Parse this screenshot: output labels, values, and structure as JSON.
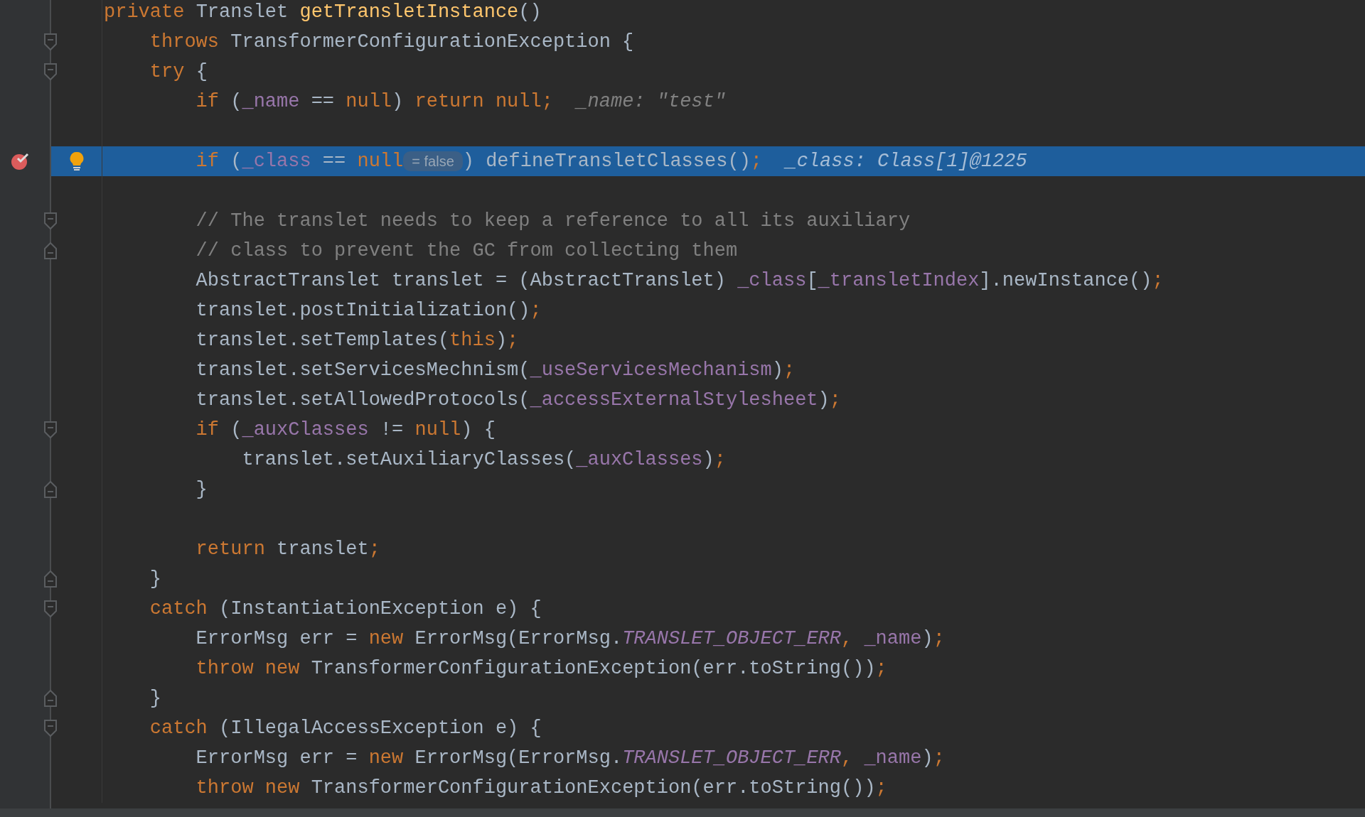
{
  "editor": {
    "lines": [
      {
        "tokens": [
          {
            "kind": "keyword",
            "text": "private "
          },
          {
            "kind": "plain",
            "text": "Translet "
          },
          {
            "kind": "method",
            "text": "getTransletInstance"
          },
          {
            "kind": "plain",
            "text": "()"
          }
        ]
      },
      {
        "fold_open": true,
        "tokens": [
          {
            "kind": "keyword",
            "text": "    throws "
          },
          {
            "kind": "plain",
            "text": "TransformerConfigurationException {"
          }
        ]
      },
      {
        "fold_open": true,
        "tokens": [
          {
            "kind": "keyword",
            "text": "    try "
          },
          {
            "kind": "plain",
            "text": "{"
          }
        ]
      },
      {
        "tokens": [
          {
            "kind": "keyword",
            "text": "        if "
          },
          {
            "kind": "plain",
            "text": "("
          },
          {
            "kind": "field",
            "text": "_name"
          },
          {
            "kind": "plain",
            "text": " == "
          },
          {
            "kind": "keyword",
            "text": "null"
          },
          {
            "kind": "plain",
            "text": ") "
          },
          {
            "kind": "keyword",
            "text": "return null;"
          },
          {
            "kind": "value",
            "text": "  _name: \"test\""
          }
        ]
      },
      {
        "selected": false
      },
      {
        "selected": true,
        "breakpoint": true,
        "bulb": true,
        "tokens": [
          {
            "kind": "keyword",
            "text": "        if "
          },
          {
            "kind": "plain",
            "text": "("
          },
          {
            "kind": "field",
            "text": "_class"
          },
          {
            "kind": "plain",
            "text": " == "
          },
          {
            "kind": "keyword",
            "text": "null"
          },
          {
            "kind": "inlay",
            "text": "= false"
          },
          {
            "kind": "plain",
            "text": ") defineTransletClasses()"
          },
          {
            "kind": "keyword",
            "text": ";"
          },
          {
            "kind": "value",
            "text": "  _class: Class[1]@1225"
          }
        ]
      },
      {
        "selected": false
      },
      {
        "fold_open": true,
        "tokens": [
          {
            "kind": "comment",
            "text": "        // The translet needs to keep a reference to all its auxiliary"
          }
        ]
      },
      {
        "fold_close": true,
        "tokens": [
          {
            "kind": "comment",
            "text": "        // class to prevent the GC from collecting them"
          }
        ]
      },
      {
        "tokens": [
          {
            "kind": "plain",
            "text": "        AbstractTranslet translet = (AbstractTranslet) "
          },
          {
            "kind": "field",
            "text": "_class"
          },
          {
            "kind": "plain",
            "text": "["
          },
          {
            "kind": "field",
            "text": "_transletIndex"
          },
          {
            "kind": "plain",
            "text": "].newInstance()"
          },
          {
            "kind": "keyword",
            "text": ";"
          }
        ]
      },
      {
        "tokens": [
          {
            "kind": "plain",
            "text": "        translet.postInitialization()"
          },
          {
            "kind": "keyword",
            "text": ";"
          }
        ]
      },
      {
        "tokens": [
          {
            "kind": "plain",
            "text": "        translet.setTemplates("
          },
          {
            "kind": "keyword",
            "text": "this"
          },
          {
            "kind": "plain",
            "text": ")"
          },
          {
            "kind": "keyword",
            "text": ";"
          }
        ]
      },
      {
        "tokens": [
          {
            "kind": "plain",
            "text": "        translet.setServicesMechnism("
          },
          {
            "kind": "field",
            "text": "_useServicesMechanism"
          },
          {
            "kind": "plain",
            "text": ")"
          },
          {
            "kind": "keyword",
            "text": ";"
          }
        ]
      },
      {
        "tokens": [
          {
            "kind": "plain",
            "text": "        translet.setAllowedProtocols("
          },
          {
            "kind": "field",
            "text": "_accessExternalStylesheet"
          },
          {
            "kind": "plain",
            "text": ")"
          },
          {
            "kind": "keyword",
            "text": ";"
          }
        ]
      },
      {
        "fold_open": true,
        "tokens": [
          {
            "kind": "keyword",
            "text": "        if "
          },
          {
            "kind": "plain",
            "text": "("
          },
          {
            "kind": "field",
            "text": "_auxClasses"
          },
          {
            "kind": "plain",
            "text": " != "
          },
          {
            "kind": "keyword",
            "text": "null"
          },
          {
            "kind": "plain",
            "text": ") {"
          }
        ]
      },
      {
        "tokens": [
          {
            "kind": "plain",
            "text": "            translet.setAuxiliaryClasses("
          },
          {
            "kind": "field",
            "text": "_auxClasses"
          },
          {
            "kind": "plain",
            "text": ")"
          },
          {
            "kind": "keyword",
            "text": ";"
          }
        ]
      },
      {
        "fold_close": true,
        "tokens": [
          {
            "kind": "plain",
            "text": "        }"
          }
        ]
      },
      {
        "selected": false
      },
      {
        "tokens": [
          {
            "kind": "keyword",
            "text": "        return "
          },
          {
            "kind": "plain",
            "text": "translet"
          },
          {
            "kind": "keyword",
            "text": ";"
          }
        ]
      },
      {
        "fold_close": true,
        "tokens": [
          {
            "kind": "plain",
            "text": "    }"
          }
        ]
      },
      {
        "fold_open": true,
        "tokens": [
          {
            "kind": "keyword",
            "text": "    catch "
          },
          {
            "kind": "plain",
            "text": "(InstantiationException e) {"
          }
        ]
      },
      {
        "tokens": [
          {
            "kind": "plain",
            "text": "        ErrorMsg err = "
          },
          {
            "kind": "keyword",
            "text": "new "
          },
          {
            "kind": "plain",
            "text": "ErrorMsg(ErrorMsg."
          },
          {
            "kind": "constant",
            "text": "TRANSLET_OBJECT_ERR"
          },
          {
            "kind": "keyword",
            "text": ", "
          },
          {
            "kind": "field",
            "text": "_name"
          },
          {
            "kind": "plain",
            "text": ")"
          },
          {
            "kind": "keyword",
            "text": ";"
          }
        ]
      },
      {
        "tokens": [
          {
            "kind": "keyword",
            "text": "        throw new "
          },
          {
            "kind": "plain",
            "text": "TransformerConfigurationException(err.toString())"
          },
          {
            "kind": "keyword",
            "text": ";"
          }
        ]
      },
      {
        "fold_close": true,
        "tokens": [
          {
            "kind": "plain",
            "text": "    }"
          }
        ]
      },
      {
        "fold_open": true,
        "tokens": [
          {
            "kind": "keyword",
            "text": "    catch "
          },
          {
            "kind": "plain",
            "text": "(IllegalAccessException e) {"
          }
        ]
      },
      {
        "tokens": [
          {
            "kind": "plain",
            "text": "        ErrorMsg err = "
          },
          {
            "kind": "keyword",
            "text": "new "
          },
          {
            "kind": "plain",
            "text": "ErrorMsg(ErrorMsg."
          },
          {
            "kind": "constant",
            "text": "TRANSLET_OBJECT_ERR"
          },
          {
            "kind": "keyword",
            "text": ", "
          },
          {
            "kind": "field",
            "text": "_name"
          },
          {
            "kind": "plain",
            "text": ")"
          },
          {
            "kind": "keyword",
            "text": ";"
          }
        ]
      },
      {
        "tokens": [
          {
            "kind": "keyword",
            "text": "        throw new "
          },
          {
            "kind": "plain",
            "text": "TransformerConfigurationException(err.toString())"
          },
          {
            "kind": "keyword",
            "text": ";"
          }
        ]
      }
    ]
  }
}
